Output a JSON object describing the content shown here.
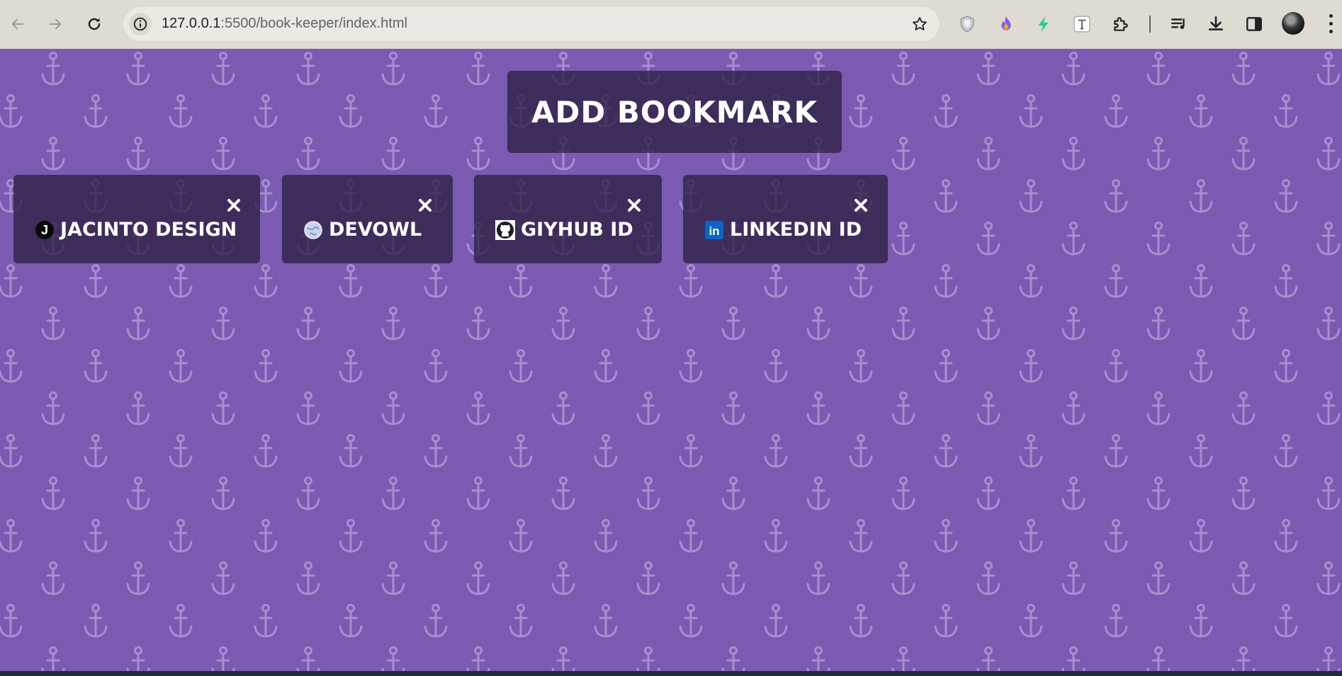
{
  "browser": {
    "url_host": "127.0.0.1",
    "url_rest": ":5500/book-keeper/index.html",
    "back_icon": "arrow-left-icon",
    "forward_icon": "arrow-right-icon",
    "reload_icon": "reload-icon",
    "info_icon": "info-icon",
    "bookmark_icon": "star-icon",
    "extension_icons": [
      "shield-icon",
      "flame-icon",
      "bolt-icon",
      "text-t-icon",
      "puzzle-icon",
      "media-queue-icon",
      "download-icon",
      "side-panel-icon"
    ]
  },
  "page": {
    "add_bookmark_label": "ADD BOOKMARK",
    "background_color": "#7b5ab2",
    "card_color": "#2d2042",
    "bookmarks": [
      {
        "name": "JACINTO DESIGN",
        "favicon": "letter-j-favicon",
        "favicon_letter": "J"
      },
      {
        "name": "DEVOWL",
        "favicon": "globe-favicon"
      },
      {
        "name": "GIYHUB ID",
        "favicon": "github-favicon"
      },
      {
        "name": "LINKEDIN ID",
        "favicon": "linkedin-favicon",
        "favicon_letter": "in"
      }
    ]
  }
}
